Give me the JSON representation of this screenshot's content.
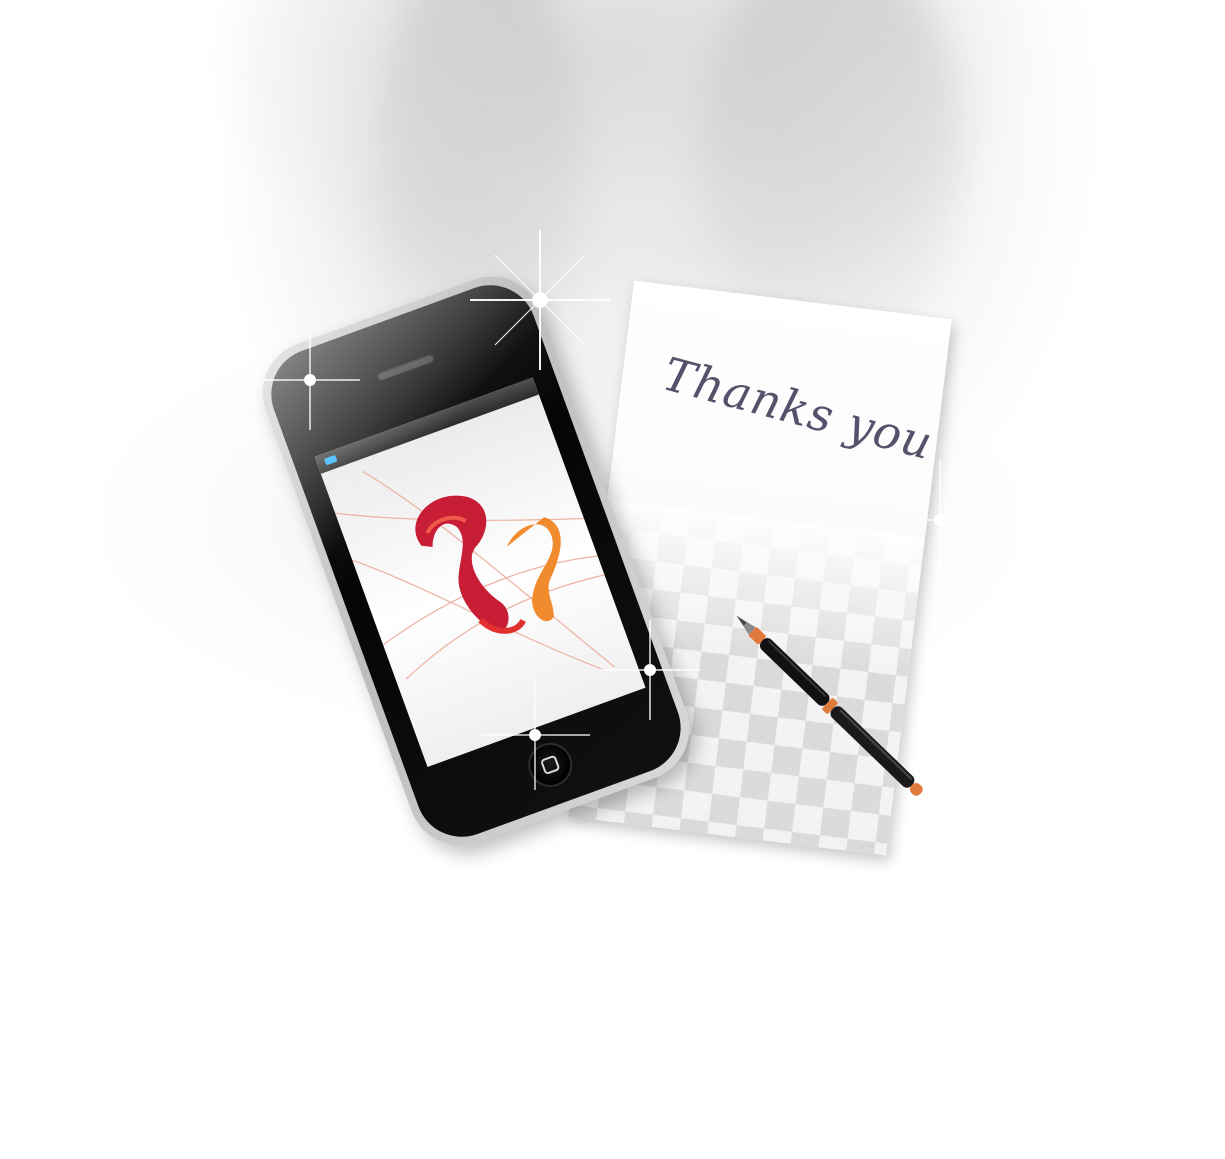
{
  "card": {
    "text": "Thanks you"
  },
  "phone": {
    "status_accent_color": "#38b6ff",
    "screen_logo": "red-orange-ribbon-logo"
  },
  "pen": {
    "body_color": "#111111",
    "trim_color": "#e07a3c"
  },
  "colors": {
    "background": "#ffffff",
    "logo_red": "#c81e35",
    "logo_orange": "#f28a2e"
  }
}
